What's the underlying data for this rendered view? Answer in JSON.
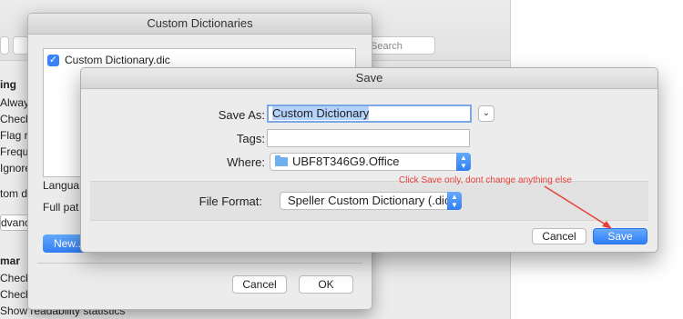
{
  "background_window": {
    "search_placeholder": "Search",
    "section_heading": "ing",
    "items": [
      "Always",
      "Check",
      "Flag re",
      "Freque",
      "Ignore"
    ],
    "custom_partial": "tom d",
    "advanced_partial": "dvanc",
    "grammar_heading": "mar",
    "grammar_items": [
      "Check",
      "Check"
    ],
    "bottom_item": "Show readability statistics"
  },
  "custom_dictionaries": {
    "title": "Custom Dictionaries",
    "list_items": [
      {
        "label": "Custom Dictionary.dic",
        "checked": true
      }
    ],
    "language_label": "Langua",
    "full_path_label": "Full pat",
    "new_button": "New...",
    "cancel_button": "Cancel",
    "ok_button": "OK"
  },
  "save_dialog": {
    "title": "Save",
    "save_as_label": "Save As:",
    "save_as_value": "Custom Dictionary",
    "tags_label": "Tags:",
    "tags_value": "",
    "where_label": "Where:",
    "where_value": "UBF8T346G9.Office",
    "file_format_label": "File Format:",
    "file_format_value": "Speller Custom Dictionary (.dic)",
    "cancel_button": "Cancel",
    "save_button": "Save"
  },
  "annotation": {
    "text": "Click Save only, dont change anything else",
    "color": "#e8413a"
  },
  "colors": {
    "accent": "#2f7ef6",
    "checkbox": "#3a83f7"
  }
}
